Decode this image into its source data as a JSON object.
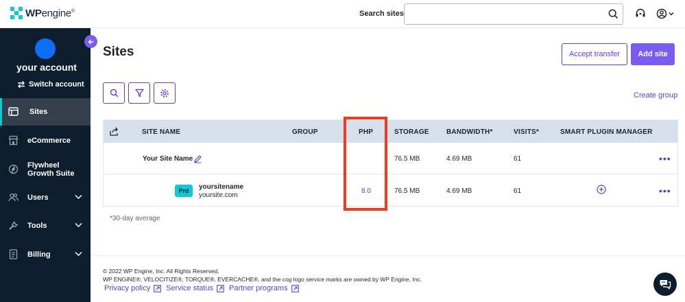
{
  "brand": {
    "logo_bold": "WP",
    "logo_thin": "engine",
    "reg": "®"
  },
  "header": {
    "search_label": "Search sites",
    "search_value": "",
    "search_placeholder": "",
    "support_icon": "headset-icon",
    "account_icon": "user-circle-icon"
  },
  "sidebar": {
    "account_name": "your account",
    "switch_label": "Switch account",
    "items": [
      {
        "label": "Sites",
        "icon": "sites-icon",
        "active": true
      },
      {
        "label": "eCommerce",
        "icon": "store-icon"
      },
      {
        "label": "Flywheel Growth Suite",
        "line1": "Flywheel",
        "line2": "Growth Suite",
        "icon": "flywheel-icon"
      },
      {
        "label": "Users",
        "icon": "users-icon",
        "expandable": true
      },
      {
        "label": "Tools",
        "icon": "wrench-icon",
        "expandable": true
      },
      {
        "label": "Billing",
        "icon": "billing-icon",
        "expandable": true
      }
    ]
  },
  "main": {
    "title": "Sites",
    "accept_transfer": "Accept transfer",
    "add_site": "Add site",
    "create_group": "Create group",
    "toolbar_icons": [
      "search-icon",
      "filter-icon",
      "settings-icon"
    ],
    "table": {
      "columns": [
        "SITE NAME",
        "GROUP",
        "PHP",
        "STORAGE",
        "BANDWIDTH*",
        "VISITS*",
        "SMART PLUGIN MANAGER"
      ],
      "site_row": {
        "name": "Your Site Name",
        "group": "",
        "php": "",
        "storage": "76.5 MB",
        "bandwidth": "4.69 MB",
        "visits": "61",
        "more": "•••"
      },
      "env_row": {
        "badge": "Prd",
        "name": "yoursitename",
        "domain": "yoursite.com",
        "php": "8.0",
        "storage": "76.5 MB",
        "bandwidth": "4.69 MB",
        "visits": "61",
        "more": "•••"
      }
    },
    "footnote": "*30-day average"
  },
  "footer": {
    "copyright": "© 2022 WP Engine, Inc. All Rights Reserved.",
    "trademark": "WP ENGINE®, VELOCITIZE®, TORQUE®, EVERCACHE®, and the cog logo service marks are owned by WP Engine, Inc.",
    "links": [
      "Privacy policy",
      "Service status",
      "Partner programs"
    ]
  },
  "colors": {
    "accent": "#5b3fd0",
    "accent_button": "#7b5cf0",
    "brand_teal": "#0ecad4",
    "sidebar_bg": "#0c1e2e",
    "highlight": "#f23b1e",
    "table_header": "#d5e0ec"
  }
}
